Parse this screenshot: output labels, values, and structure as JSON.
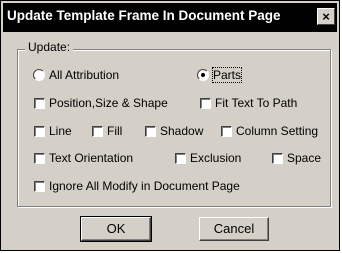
{
  "dialog": {
    "title": "Update Template Frame In Document Page",
    "close_label": "×"
  },
  "update_group": {
    "label": "Update:",
    "radio_all_attribution": "All Attribution",
    "radio_parts": "Parts",
    "position_size_shape": "Position,Size & Shape",
    "fit_text_to_path": "Fit Text To Path",
    "line": "Line",
    "fill": "Fill",
    "shadow": "Shadow",
    "column_setting": "Column Setting",
    "text_orientation": "Text Orientation",
    "exclusion": "Exclusion",
    "space": "Space",
    "ignore_all_modify": "Ignore All Modify in Document Page"
  },
  "buttons": {
    "ok": "OK",
    "cancel": "Cancel"
  }
}
